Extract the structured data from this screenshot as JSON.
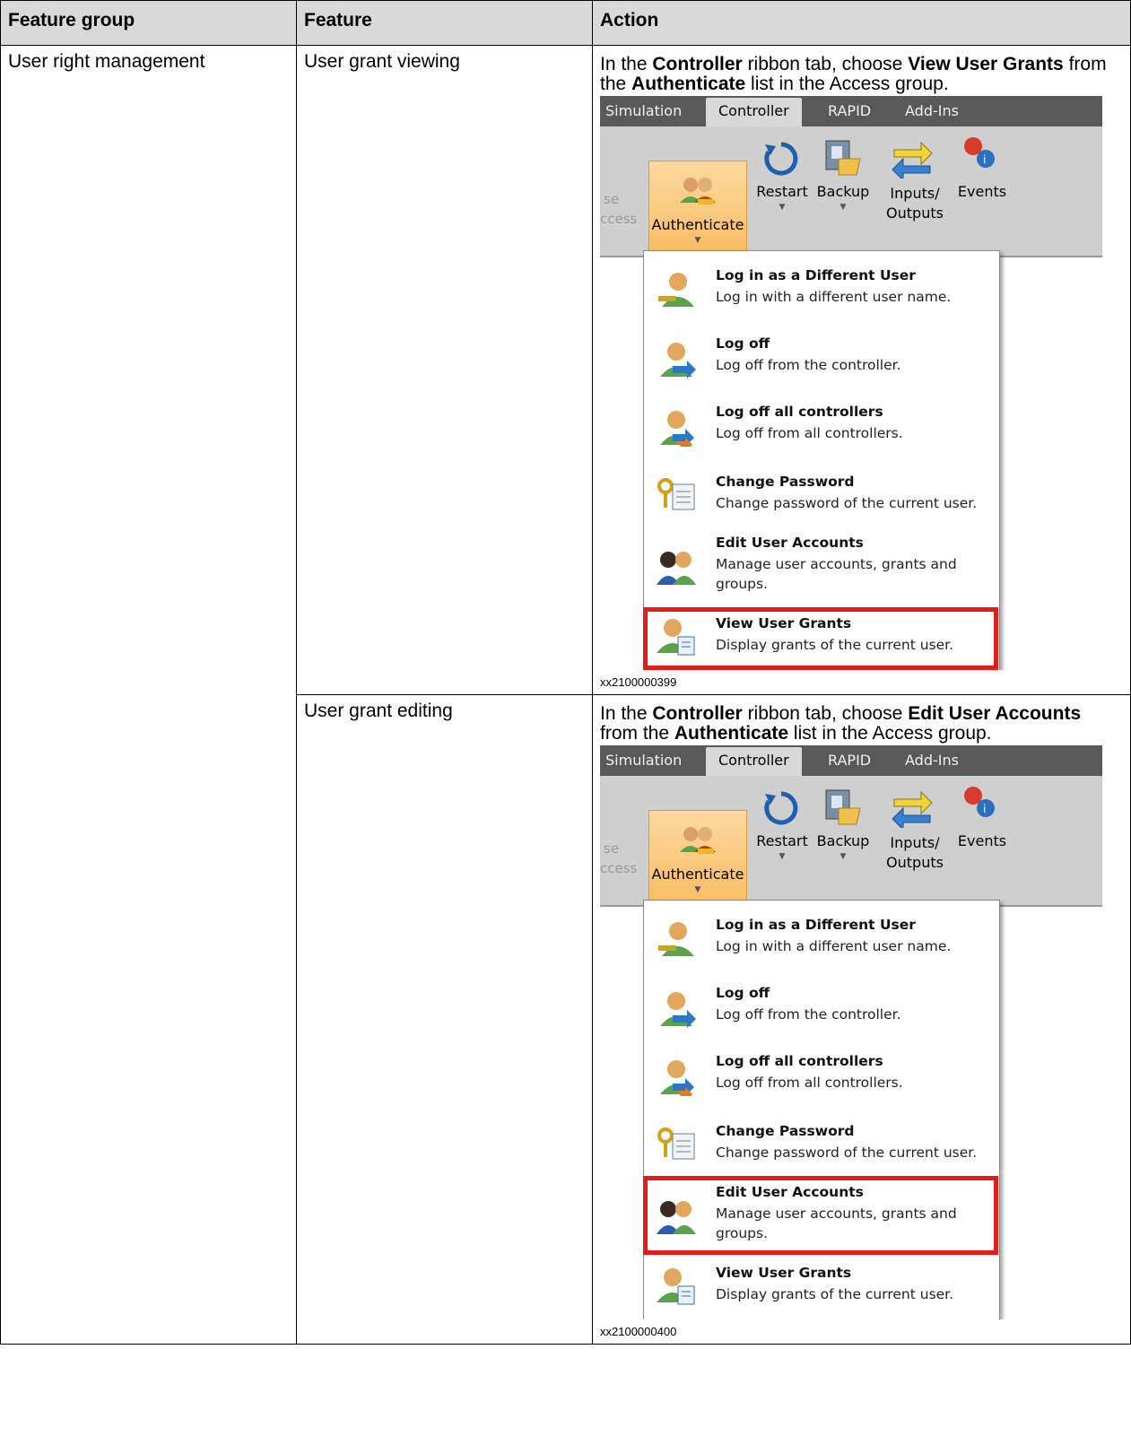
{
  "table": {
    "headers": [
      "Feature group",
      "Feature",
      "Action"
    ],
    "feature_group": "User right management",
    "rows": [
      {
        "feature": "User grant viewing",
        "action": {
          "p1": "In the ",
          "b1": "Controller",
          "p2": " ribbon tab, choose ",
          "b2": "View User Grants",
          "p3": " from the ",
          "b3": "Authenticate",
          "p4": " list in the Access group."
        },
        "figure_id": "xx2100000399",
        "highlighted_item": "View User Grants"
      },
      {
        "feature": "User grant editing",
        "action": {
          "p1": "In the ",
          "b1": "Controller",
          "p2": " ribbon tab, choose ",
          "b2": "Edit User Accounts",
          "p3": " from the ",
          "b3": "Authenticate",
          "p4": " list in the Access group."
        },
        "figure_id": "xx2100000400",
        "highlighted_item": "Edit User Accounts"
      }
    ]
  },
  "screenshot": {
    "tabs": [
      "Simulation",
      "Controller",
      "RAPID",
      "Add-Ins"
    ],
    "active_tab": "Controller",
    "faded_left_top": "se",
    "faded_left_bottom": "ccess",
    "buttons": {
      "authenticate": "Authenticate",
      "restart": "Restart",
      "backup": "Backup",
      "inputs_outputs_1": "Inputs/",
      "inputs_outputs_2": "Outputs",
      "events": "Events"
    },
    "menu_items": [
      {
        "title": "Log in as a Different User",
        "desc": "Log in with a different user name.",
        "icon": "user-key-icon"
      },
      {
        "title": "Log off",
        "desc": "Log off from the controller.",
        "icon": "user-logoff-icon"
      },
      {
        "title": "Log off all controllers",
        "desc": "Log off from all controllers.",
        "icon": "user-logoff-all-icon"
      },
      {
        "title": "Change Password",
        "desc": "Change password of the current user.",
        "icon": "keys-password-icon"
      },
      {
        "title": "Edit User Accounts",
        "desc": "Manage user accounts, grants and groups.",
        "icon": "user-accounts-icon"
      },
      {
        "title": "View User Grants",
        "desc": "Display grants of the current user.",
        "icon": "user-grants-icon"
      }
    ]
  },
  "colors": {
    "header_bg": "#d9d9d9",
    "highlight": "#e31b1b",
    "authenticate_bg": "#f8b451",
    "tabbar_bg": "#595959"
  }
}
